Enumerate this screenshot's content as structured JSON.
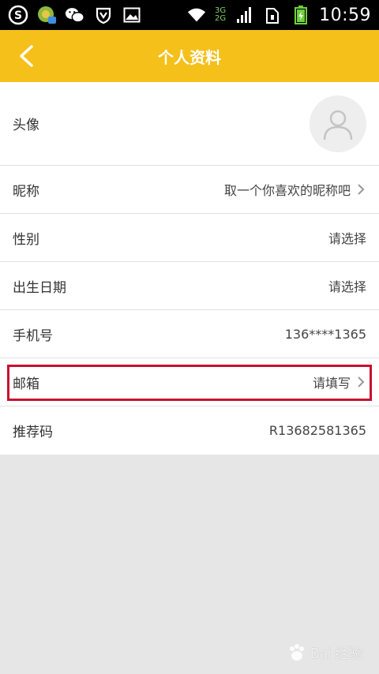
{
  "status_bar": {
    "time": "10:59",
    "network_top": "3G",
    "network_bottom": "2G",
    "icons": [
      "sogou-icon",
      "app-icon",
      "wechat-icon",
      "shield-icon",
      "image-icon",
      "wifi-icon",
      "signal-icon",
      "sim-icon",
      "battery-icon"
    ]
  },
  "header": {
    "title": "个人资料",
    "back_icon": "chevron-left-icon"
  },
  "profile": {
    "avatar_label": "头像",
    "rows": [
      {
        "label": "昵称",
        "value": "取一个你喜欢的昵称吧",
        "chevron": true
      },
      {
        "label": "性别",
        "value": "请选择",
        "chevron": false
      },
      {
        "label": "出生日期",
        "value": "请选择",
        "chevron": false
      },
      {
        "label": "手机号",
        "value": "136****1365",
        "chevron": false
      },
      {
        "label": "邮箱",
        "value": "请填写",
        "chevron": true
      },
      {
        "label": "推荐码",
        "value": "R13682581365",
        "chevron": false
      }
    ]
  },
  "watermark": {
    "text": "Bai 经验"
  },
  "colors": {
    "header": "#f5c01a",
    "highlight_border": "#c8102e"
  }
}
